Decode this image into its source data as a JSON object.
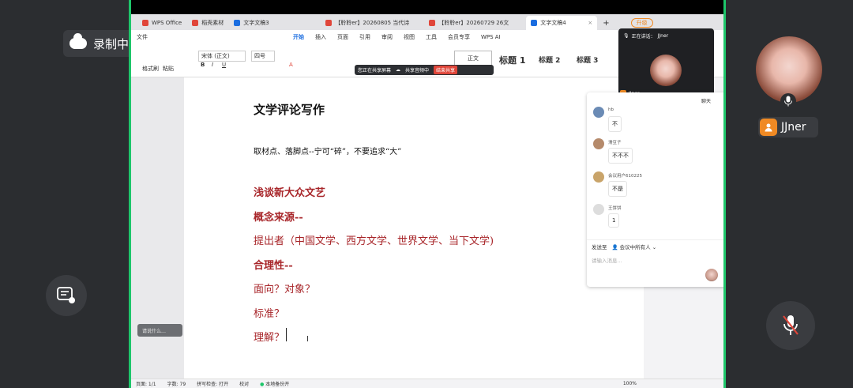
{
  "meeting": {
    "recording_label": "录制中",
    "participant_name": "JJner",
    "colors": {
      "accent": "#1ec66a",
      "avatar_badge": "#f08a24",
      "bg": "#2b2d30"
    }
  },
  "wps": {
    "tabs": [
      {
        "label": "WPS Office",
        "color": "#e0463a"
      },
      {
        "label": "稻壳素材",
        "color": "#e0463a"
      },
      {
        "label": "文字文稿3",
        "color": "#1a6de0"
      },
      {
        "label": "【聆聆er】20260805 当代诗",
        "color": "#e0463a"
      },
      {
        "label": "【聆聆er】20260729 26文",
        "color": "#e0463a"
      },
      {
        "label": "文字文稿4",
        "color": "#1a6de0"
      }
    ],
    "upgrade_label": "升级",
    "menu": [
      "文件",
      "开始",
      "插入",
      "页面",
      "引用",
      "审阅",
      "视图",
      "工具",
      "会员专享",
      "WPS AI"
    ],
    "active_menu": "开始",
    "ribbon": {
      "format_painter": "格式刷",
      "paste": "粘贴",
      "font_name": "宋体 (正文)",
      "font_size": "四号",
      "style_normal": "正文",
      "style_h1": "标题 1",
      "style_h2": "标题 2",
      "style_h3": "标题 3"
    },
    "share_bar": {
      "sharing": "您正在共享屏幕",
      "audio": "共享音频中",
      "stop": "结束共享"
    },
    "status": {
      "page": "页面: 1/1",
      "words": "字数: 79",
      "spell": "拼写检查: 打开",
      "proof": "校对",
      "backup": "本地备份开",
      "zoom": "100%"
    },
    "bottom_hint": "请说什么…"
  },
  "document": {
    "title": "文学评论写作",
    "subtitle": "取材点、落脚点--宁可“碎”，不要追求“大”",
    "lines": [
      {
        "text": "浅谈新大众文艺",
        "bold": true
      },
      {
        "text": "概念来源--",
        "bold": true
      },
      {
        "text": "提出者（中国文学、西方文学、世界文学、当下文学)",
        "bold": false
      },
      {
        "text": "合理性--",
        "bold": true
      },
      {
        "text": "面向？对象？",
        "bold": false
      },
      {
        "text": "标准？",
        "bold": false
      },
      {
        "text": "理解？",
        "bold": false
      }
    ]
  },
  "video_popup": {
    "speaking": "正在讲话：",
    "speaker": "JJner",
    "name": "JJner"
  },
  "chat": {
    "header_right": "聊天",
    "messages": [
      {
        "name": "hb",
        "text": "不"
      },
      {
        "name": "滑豆子",
        "text": "不不不"
      },
      {
        "name": "会议用户610225",
        "text": "不是"
      },
      {
        "name": "王饼饼",
        "text": "1"
      }
    ],
    "send_to_label": "发送至",
    "send_to_value": "会议中所有人",
    "input_placeholder": "请输入消息..."
  }
}
